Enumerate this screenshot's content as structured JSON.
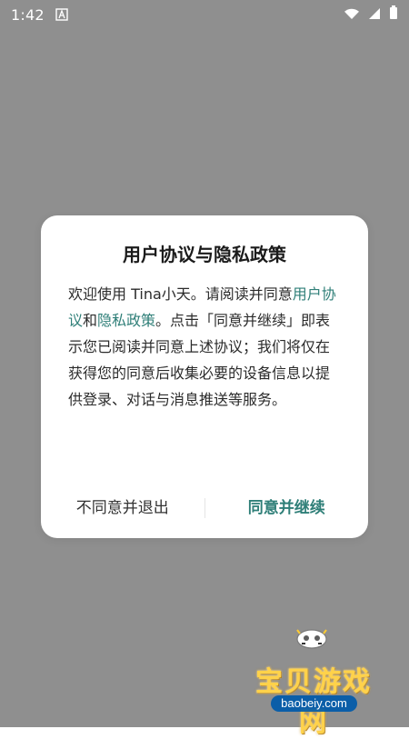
{
  "status_bar": {
    "time": "1:42",
    "icons": [
      "a-icon",
      "wifi-icon",
      "signal-icon",
      "battery-icon"
    ]
  },
  "dialog": {
    "title": "用户协议与隐私政策",
    "body": {
      "part1": "欢迎使用 Tina小天。请阅读并同意",
      "link_user_agreement": "用户协议",
      "part2": "和",
      "link_privacy_policy": "隐私政策",
      "part3": "。点击「同意并继续」即表示您已阅读并同意上述协议；我们将仅在获得您的同意后收集必要的设备信息以提供登录、对话与消息推送等服务。"
    },
    "actions": {
      "disagree": "不同意并退出",
      "agree": "同意并继续"
    }
  },
  "watermark": {
    "title": "宝贝游戏网",
    "url": "baobeiy.com"
  },
  "colors": {
    "overlay": "#8f8f8f",
    "accent": "#2f7f78",
    "dialog_bg": "#ffffff",
    "watermark_text": "#ffd24a",
    "watermark_url_bg": "#005aaa"
  }
}
